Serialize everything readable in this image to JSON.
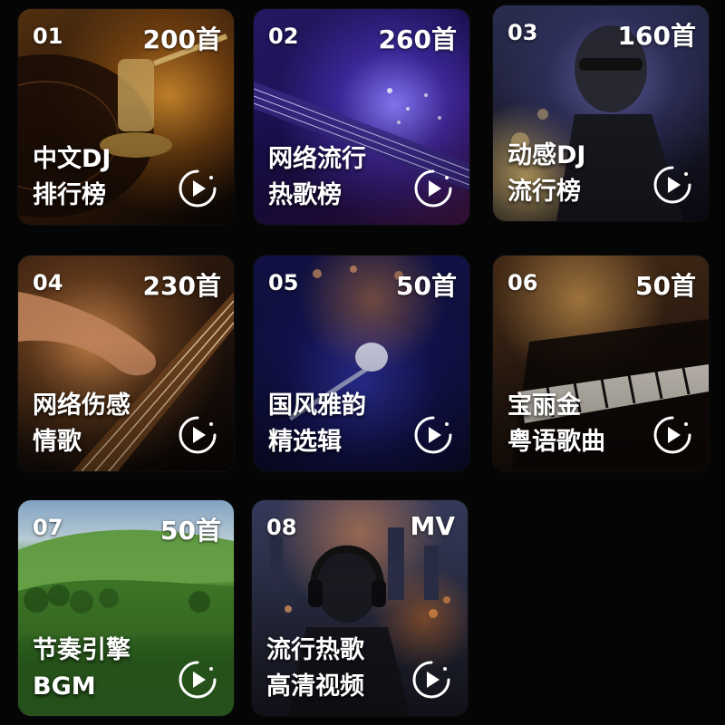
{
  "playlists": [
    {
      "num": "01",
      "count": "200首",
      "line1": "中文DJ",
      "line2": "排行榜"
    },
    {
      "num": "02",
      "count": "260首",
      "line1": "网络流行",
      "line2": "热歌榜"
    },
    {
      "num": "03",
      "count": "160首",
      "line1": "动感DJ",
      "line2": "流行榜"
    },
    {
      "num": "04",
      "count": "230首",
      "line1": "网络伤感",
      "line2": "情歌"
    },
    {
      "num": "05",
      "count": "50首",
      "line1": "国风雅韵",
      "line2": "精选辑"
    },
    {
      "num": "06",
      "count": "50首",
      "line1": "宝丽金",
      "line2": "粤语歌曲"
    },
    {
      "num": "07",
      "count": "50首",
      "line1": "节奏引擎",
      "line2": "BGM"
    },
    {
      "num": "08",
      "count": "MV",
      "line1": "流行热歌",
      "line2": "高清视频"
    }
  ],
  "icons": {
    "play": "play-circle-icon"
  },
  "colors": {
    "background": "#050505",
    "text": "#ffffff"
  }
}
